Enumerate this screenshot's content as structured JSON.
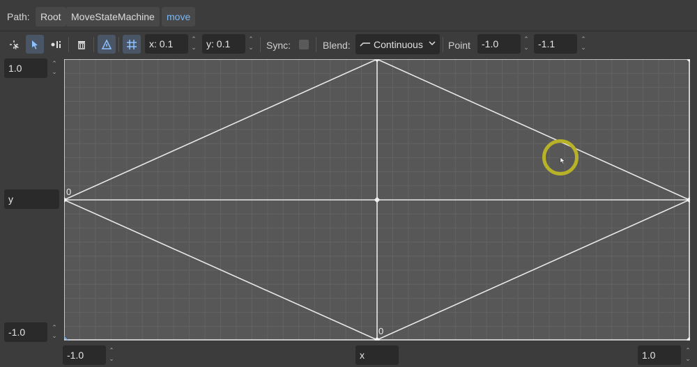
{
  "path": {
    "label": "Path:",
    "crumbs": [
      "Root",
      "MoveStateMachine",
      "move"
    ]
  },
  "toolbar": {
    "tools": [
      "create-point-icon",
      "select-icon",
      "create-triangle-icon",
      "delete-icon",
      "blend-triangles-icon",
      "snap-grid-icon"
    ],
    "snap_x": "x: 0.1",
    "snap_y": "y: 0.1",
    "sync_label": "Sync:",
    "sync_checked": false,
    "blend_label": "Blend:",
    "blend_value": "Continuous",
    "point_label": "Point",
    "point_x": "-1.0",
    "point_y": "-1.1"
  },
  "space": {
    "max_y": "1.0",
    "y_label": "y",
    "min_y": "-1.0",
    "min_x": "-1.0",
    "x_label": "x",
    "max_x": "1.0",
    "zero_label": "0"
  },
  "colors": {
    "accent": "#7cb8f5",
    "highlight_ring": "#b8b228"
  }
}
